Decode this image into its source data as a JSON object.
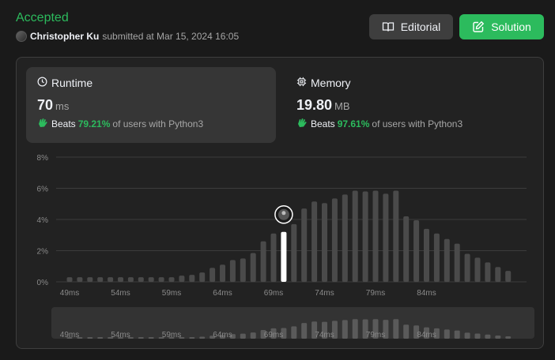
{
  "submission": {
    "status": "Accepted",
    "user": "Christopher Ku",
    "submitted_text": "submitted at Mar 15, 2024 16:05"
  },
  "buttons": {
    "editorial": "Editorial",
    "solution": "Solution"
  },
  "runtime": {
    "title": "Runtime",
    "value": "70",
    "unit": "ms",
    "beats_label": "Beats",
    "beats_pct": "79.21%",
    "beats_suffix": "of users with Python3"
  },
  "memory": {
    "title": "Memory",
    "value": "19.80",
    "unit": "MB",
    "beats_label": "Beats",
    "beats_pct": "97.61%",
    "beats_suffix": "of users with Python3"
  },
  "colors": {
    "accent": "#2cbb5d",
    "bar": "#4a4a4a",
    "highlight": "#ffffff"
  },
  "chart_data": {
    "type": "bar",
    "ylim": [
      0,
      8
    ],
    "yticks": [
      "0%",
      "2%",
      "4%",
      "6%",
      "8%"
    ],
    "xticks": [
      "49ms",
      "54ms",
      "59ms",
      "64ms",
      "69ms",
      "74ms",
      "79ms",
      "84ms"
    ],
    "x_start": 49,
    "highlight_ms": 70,
    "values": [
      0.3,
      0.3,
      0.3,
      0.3,
      0.3,
      0.3,
      0.3,
      0.3,
      0.3,
      0.3,
      0.3,
      0.4,
      0.45,
      0.6,
      0.9,
      1.1,
      1.4,
      1.5,
      1.85,
      2.6,
      3.1,
      3.2,
      3.7,
      4.7,
      5.15,
      5.05,
      5.35,
      5.6,
      5.85,
      5.8,
      5.85,
      5.65,
      5.85,
      4.2,
      3.95,
      3.4,
      3.1,
      2.75,
      2.45,
      1.8,
      1.55,
      1.25,
      0.95,
      0.7
    ],
    "grid": true
  }
}
